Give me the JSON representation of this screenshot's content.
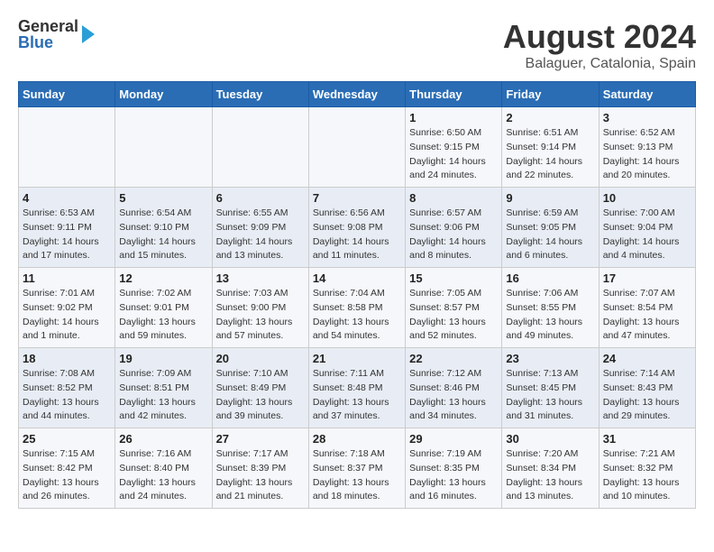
{
  "logo": {
    "general": "General",
    "blue": "Blue"
  },
  "title": "August 2024",
  "subtitle": "Balaguer, Catalonia, Spain",
  "headers": [
    "Sunday",
    "Monday",
    "Tuesday",
    "Wednesday",
    "Thursday",
    "Friday",
    "Saturday"
  ],
  "weeks": [
    [
      {
        "day": "",
        "info": ""
      },
      {
        "day": "",
        "info": ""
      },
      {
        "day": "",
        "info": ""
      },
      {
        "day": "",
        "info": ""
      },
      {
        "day": "1",
        "info": "Sunrise: 6:50 AM\nSunset: 9:15 PM\nDaylight: 14 hours\nand 24 minutes."
      },
      {
        "day": "2",
        "info": "Sunrise: 6:51 AM\nSunset: 9:14 PM\nDaylight: 14 hours\nand 22 minutes."
      },
      {
        "day": "3",
        "info": "Sunrise: 6:52 AM\nSunset: 9:13 PM\nDaylight: 14 hours\nand 20 minutes."
      }
    ],
    [
      {
        "day": "4",
        "info": "Sunrise: 6:53 AM\nSunset: 9:11 PM\nDaylight: 14 hours\nand 17 minutes."
      },
      {
        "day": "5",
        "info": "Sunrise: 6:54 AM\nSunset: 9:10 PM\nDaylight: 14 hours\nand 15 minutes."
      },
      {
        "day": "6",
        "info": "Sunrise: 6:55 AM\nSunset: 9:09 PM\nDaylight: 14 hours\nand 13 minutes."
      },
      {
        "day": "7",
        "info": "Sunrise: 6:56 AM\nSunset: 9:08 PM\nDaylight: 14 hours\nand 11 minutes."
      },
      {
        "day": "8",
        "info": "Sunrise: 6:57 AM\nSunset: 9:06 PM\nDaylight: 14 hours\nand 8 minutes."
      },
      {
        "day": "9",
        "info": "Sunrise: 6:59 AM\nSunset: 9:05 PM\nDaylight: 14 hours\nand 6 minutes."
      },
      {
        "day": "10",
        "info": "Sunrise: 7:00 AM\nSunset: 9:04 PM\nDaylight: 14 hours\nand 4 minutes."
      }
    ],
    [
      {
        "day": "11",
        "info": "Sunrise: 7:01 AM\nSunset: 9:02 PM\nDaylight: 14 hours\nand 1 minute."
      },
      {
        "day": "12",
        "info": "Sunrise: 7:02 AM\nSunset: 9:01 PM\nDaylight: 13 hours\nand 59 minutes."
      },
      {
        "day": "13",
        "info": "Sunrise: 7:03 AM\nSunset: 9:00 PM\nDaylight: 13 hours\nand 57 minutes."
      },
      {
        "day": "14",
        "info": "Sunrise: 7:04 AM\nSunset: 8:58 PM\nDaylight: 13 hours\nand 54 minutes."
      },
      {
        "day": "15",
        "info": "Sunrise: 7:05 AM\nSunset: 8:57 PM\nDaylight: 13 hours\nand 52 minutes."
      },
      {
        "day": "16",
        "info": "Sunrise: 7:06 AM\nSunset: 8:55 PM\nDaylight: 13 hours\nand 49 minutes."
      },
      {
        "day": "17",
        "info": "Sunrise: 7:07 AM\nSunset: 8:54 PM\nDaylight: 13 hours\nand 47 minutes."
      }
    ],
    [
      {
        "day": "18",
        "info": "Sunrise: 7:08 AM\nSunset: 8:52 PM\nDaylight: 13 hours\nand 44 minutes."
      },
      {
        "day": "19",
        "info": "Sunrise: 7:09 AM\nSunset: 8:51 PM\nDaylight: 13 hours\nand 42 minutes."
      },
      {
        "day": "20",
        "info": "Sunrise: 7:10 AM\nSunset: 8:49 PM\nDaylight: 13 hours\nand 39 minutes."
      },
      {
        "day": "21",
        "info": "Sunrise: 7:11 AM\nSunset: 8:48 PM\nDaylight: 13 hours\nand 37 minutes."
      },
      {
        "day": "22",
        "info": "Sunrise: 7:12 AM\nSunset: 8:46 PM\nDaylight: 13 hours\nand 34 minutes."
      },
      {
        "day": "23",
        "info": "Sunrise: 7:13 AM\nSunset: 8:45 PM\nDaylight: 13 hours\nand 31 minutes."
      },
      {
        "day": "24",
        "info": "Sunrise: 7:14 AM\nSunset: 8:43 PM\nDaylight: 13 hours\nand 29 minutes."
      }
    ],
    [
      {
        "day": "25",
        "info": "Sunrise: 7:15 AM\nSunset: 8:42 PM\nDaylight: 13 hours\nand 26 minutes."
      },
      {
        "day": "26",
        "info": "Sunrise: 7:16 AM\nSunset: 8:40 PM\nDaylight: 13 hours\nand 24 minutes."
      },
      {
        "day": "27",
        "info": "Sunrise: 7:17 AM\nSunset: 8:39 PM\nDaylight: 13 hours\nand 21 minutes."
      },
      {
        "day": "28",
        "info": "Sunrise: 7:18 AM\nSunset: 8:37 PM\nDaylight: 13 hours\nand 18 minutes."
      },
      {
        "day": "29",
        "info": "Sunrise: 7:19 AM\nSunset: 8:35 PM\nDaylight: 13 hours\nand 16 minutes."
      },
      {
        "day": "30",
        "info": "Sunrise: 7:20 AM\nSunset: 8:34 PM\nDaylight: 13 hours\nand 13 minutes."
      },
      {
        "day": "31",
        "info": "Sunrise: 7:21 AM\nSunset: 8:32 PM\nDaylight: 13 hours\nand 10 minutes."
      }
    ]
  ]
}
